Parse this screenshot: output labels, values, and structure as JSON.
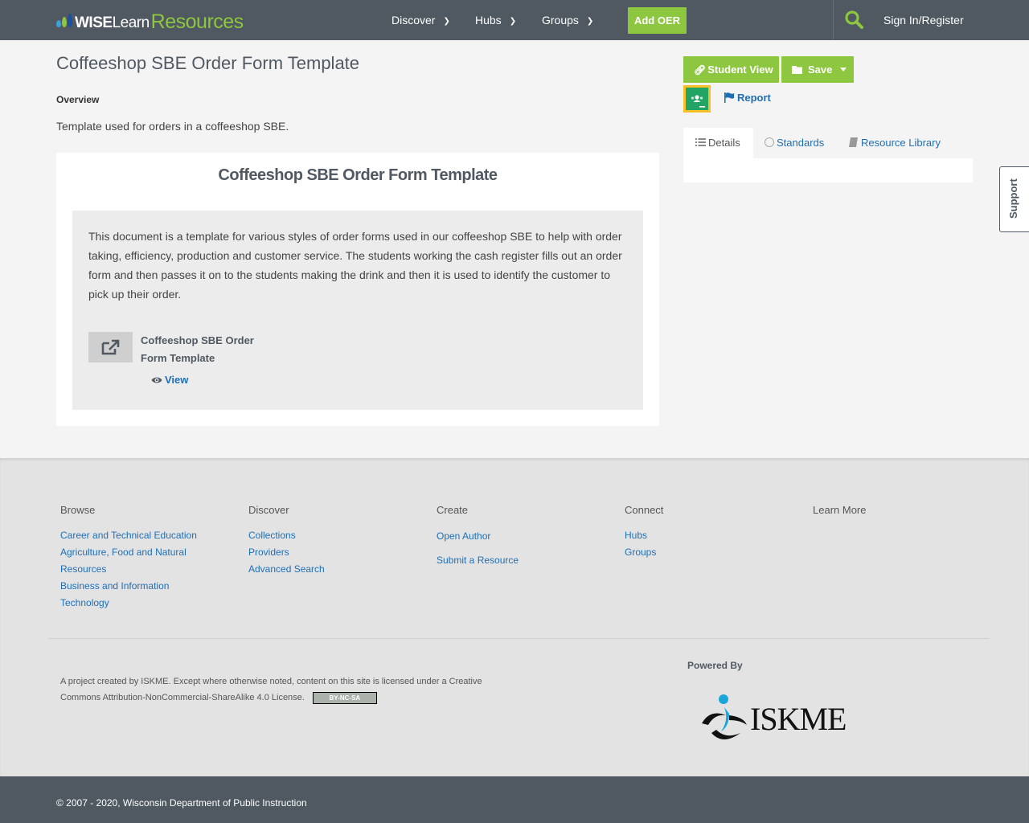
{
  "header": {
    "logo": {
      "wise": "WISE",
      "learn": "Learn",
      "resources": "Resources"
    },
    "nav": [
      {
        "label": "Discover"
      },
      {
        "label": "Hubs"
      },
      {
        "label": "Groups"
      }
    ],
    "add_oer_label": "Add OER",
    "sign_in_label": "Sign In/Register",
    "icons": {
      "search": "search-icon",
      "chevron": "chevron-down-icon"
    }
  },
  "resource": {
    "title": "Coffeeshop SBE Order Form Template",
    "overview_label": "Overview",
    "overview_text": "Template used for orders in a coffeeshop SBE.",
    "card_title": "Coffeeshop SBE Order Form Template",
    "description": "This document is a template for various styles of order forms used in our coffeeshop SBE to help with order taking, efficiency, production and customer service. The students working the cash register fills out an order form and then passes it on to the students making the drink and then it is used to identify the customer to pick up their order.",
    "link_title": "Coffeeshop SBE Order Form Template",
    "view_label": "View"
  },
  "sidebar": {
    "student_view_label": "Student View",
    "save_label": "Save",
    "report_label": "Report",
    "tabs": [
      {
        "label": "Details"
      },
      {
        "label": "Standards"
      },
      {
        "label": "Resource Library"
      }
    ],
    "support_label": "Support"
  },
  "footer": {
    "columns": [
      {
        "heading": "Browse",
        "links": [
          "Career and Technical Education",
          "Agriculture, Food and Natural Resources",
          "Business and Information Technology"
        ]
      },
      {
        "heading": "Discover",
        "links": [
          "Collections",
          "Providers",
          "Advanced Search"
        ]
      },
      {
        "heading": "Create",
        "links": [
          "Open Author",
          "Submit a Resource"
        ]
      },
      {
        "heading": "Connect",
        "links": [
          "Hubs",
          "Groups"
        ]
      },
      {
        "heading": "Learn More",
        "links": []
      }
    ],
    "license_text": "A project created by ISKME. Except where otherwise noted, content on this site is licensed under a Creative Commons Attribution-NonCommercial-ShareAlike 4.0 License.",
    "cc_badge": "BY-NC-SA",
    "powered_by": "Powered By",
    "iskme": "ISKME",
    "copyright": "© 2007 - 2020, Wisconsin Department of Public Instruction"
  },
  "colors": {
    "header_bg": "#505962",
    "accent_green": "#8dc63f",
    "link_blue": "#1f6fb5",
    "page_bg": "#f4f4f4",
    "footer_bg": "#e3e3e3"
  }
}
